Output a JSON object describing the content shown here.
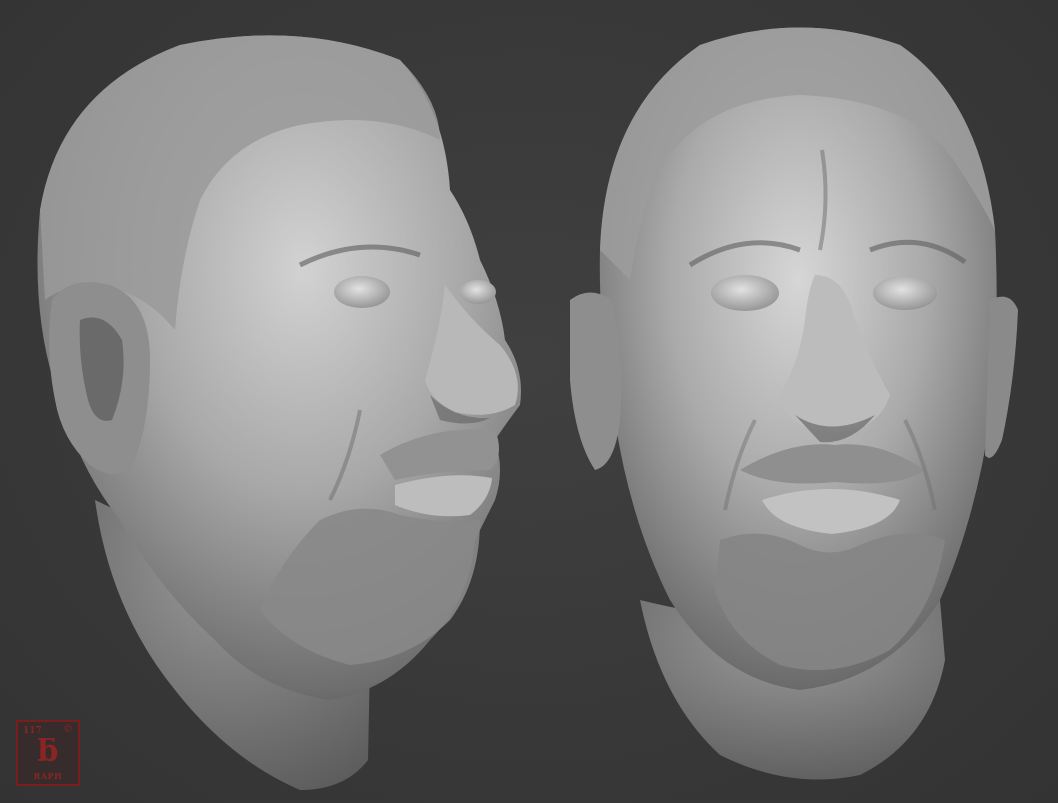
{
  "image": {
    "description_colors": {
      "background": "#3b3b3b",
      "sculpt_clay": "#a9a9a9",
      "logo_red": "#8c2424"
    }
  },
  "logo": {
    "number": "117",
    "symbol": "©",
    "glyph": "ƃ",
    "name": "RAPH"
  }
}
